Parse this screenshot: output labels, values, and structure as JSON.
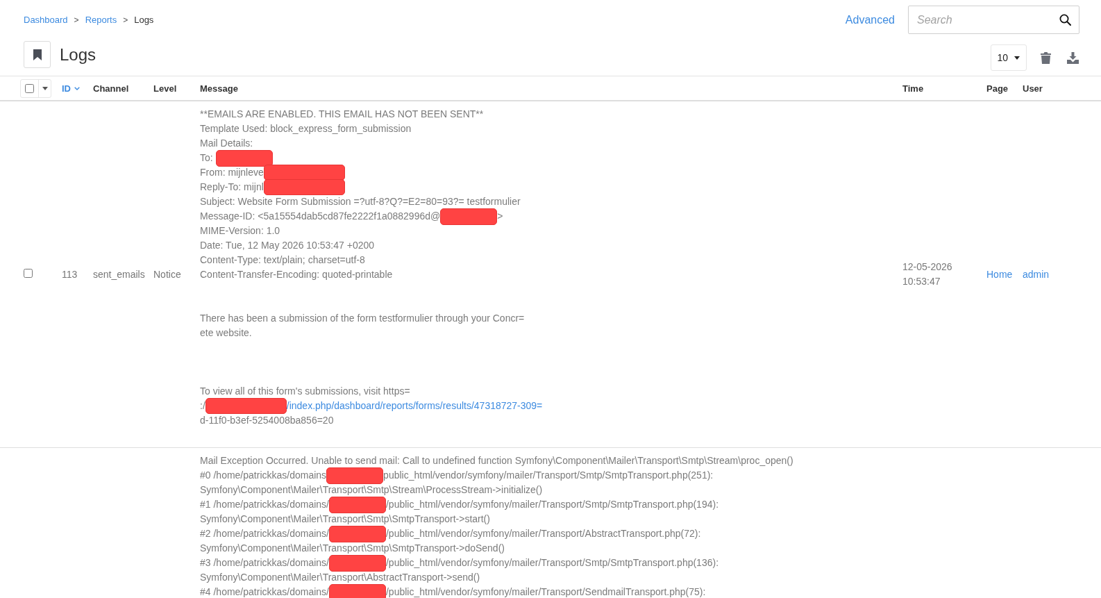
{
  "breadcrumb": [
    {
      "kind": "link",
      "label": "Dashboard"
    },
    {
      "kind": "separator",
      "label": ">"
    },
    {
      "kind": "link",
      "label": "Reports"
    },
    {
      "kind": "separator",
      "label": ">"
    },
    {
      "kind": "current",
      "label": "Logs"
    }
  ],
  "header_actions": {
    "advanced_link": "Advanced",
    "search": {
      "placeholder": "Search"
    }
  },
  "page_title": "Logs",
  "toolbar": {
    "per_page": "10"
  },
  "table": {
    "select_all": {
      "checked": false
    },
    "columns": [
      {
        "label": "ID",
        "sorted": true
      },
      {
        "label": "Channel",
        "sorted": false
      },
      {
        "label": "Level",
        "sorted": false
      },
      {
        "label": "Message",
        "sorted": false
      },
      {
        "label": "Time",
        "sorted": false
      },
      {
        "label": "Page",
        "sorted": false
      },
      {
        "label": "User",
        "sorted": false
      }
    ],
    "rows": [
      {
        "selected": false,
        "id": "113",
        "channel": "sent_emails",
        "level": "Notice",
        "time": "12-05-2026 10:53:47",
        "page": "Home",
        "user": "admin",
        "message": [
          {
            "kind": "text",
            "text": "**EMAILS ARE ENABLED. THIS EMAIL HAS NOT BEEN SENT**"
          },
          {
            "kind": "text",
            "text": "Template Used: block_express_form_submission"
          },
          {
            "kind": "text",
            "text": "Mail Details:"
          },
          {
            "kind": "mixed",
            "parts": [
              {
                "kind": "text",
                "text": "To: "
              },
              {
                "kind": "redaction"
              }
            ]
          },
          {
            "kind": "mixed",
            "parts": [
              {
                "kind": "text",
                "text": "From: mijnleve"
              },
              {
                "kind": "wide_redaction"
              }
            ]
          },
          {
            "kind": "mixed",
            "parts": [
              {
                "kind": "text",
                "text": "Reply-To: mijnl"
              },
              {
                "kind": "wide_redaction"
              }
            ]
          },
          {
            "kind": "text",
            "text": "Subject: Website Form Submission =?utf-8?Q?=E2=80=93?= testformulier"
          },
          {
            "kind": "mixed",
            "parts": [
              {
                "kind": "text",
                "text": "Message-ID: <5a15554dab5cd87fe2222f1a0882996d@"
              },
              {
                "kind": "redaction"
              },
              {
                "kind": "text",
                "text": ">"
              }
            ]
          },
          {
            "kind": "text",
            "text": "MIME-Version: 1.0"
          },
          {
            "kind": "text",
            "text": "Date: Tue, 12 May 2026 10:53:47 +0200"
          },
          {
            "kind": "text",
            "text": "Content-Type: text/plain; charset=utf-8"
          },
          {
            "kind": "text",
            "text": "Content-Transfer-Encoding: quoted-printable"
          },
          {
            "kind": "blank"
          },
          {
            "kind": "blank"
          },
          {
            "kind": "text",
            "text": "There has been a submission of the form testformulier through your Concr="
          },
          {
            "kind": "text",
            "text": "ete website."
          },
          {
            "kind": "blank"
          },
          {
            "kind": "blank"
          },
          {
            "kind": "blank"
          },
          {
            "kind": "text",
            "text": "To view all of this form's submissions, visit https="
          },
          {
            "kind": "mixed",
            "parts": [
              {
                "kind": "text",
                "text": ":/"
              },
              {
                "kind": "wide_redaction"
              },
              {
                "kind": "link",
                "text": "/index.php/dashboard/reports/forms/results/47318727-309="
              }
            ]
          },
          {
            "kind": "text",
            "text": "d-11f0-b3ef-5254008ba856=20"
          }
        ]
      },
      {
        "message": [
          {
            "kind": "text",
            "text": "Mail Exception Occurred. Unable to send mail: Call to undefined function Symfony\\Component\\Mailer\\Transport\\Smtp\\Stream\\proc_open()"
          },
          {
            "kind": "mixed",
            "parts": [
              {
                "kind": "text",
                "text": "#0 /home/patrickkas/domains"
              },
              {
                "kind": "redaction"
              },
              {
                "kind": "text",
                "text": "public_html/vendor/symfony/mailer/Transport/Smtp/SmtpTransport.php(251):"
              }
            ]
          },
          {
            "kind": "text",
            "text": "Symfony\\Component\\Mailer\\Transport\\Smtp\\Stream\\ProcessStream->initialize()"
          },
          {
            "kind": "mixed",
            "parts": [
              {
                "kind": "text",
                "text": "#1 /home/patrickkas/domains/"
              },
              {
                "kind": "redaction"
              },
              {
                "kind": "text",
                "text": "/public_html/vendor/symfony/mailer/Transport/Smtp/SmtpTransport.php(194):"
              }
            ]
          },
          {
            "kind": "text",
            "text": "Symfony\\Component\\Mailer\\Transport\\Smtp\\SmtpTransport->start()"
          },
          {
            "kind": "mixed",
            "parts": [
              {
                "kind": "text",
                "text": "#2 /home/patrickkas/domains/"
              },
              {
                "kind": "redaction"
              },
              {
                "kind": "text",
                "text": "/public_html/vendor/symfony/mailer/Transport/AbstractTransport.php(72):"
              }
            ]
          },
          {
            "kind": "text",
            "text": "Symfony\\Component\\Mailer\\Transport\\Smtp\\SmtpTransport->doSend()"
          },
          {
            "kind": "mixed",
            "parts": [
              {
                "kind": "text",
                "text": "#3 /home/patrickkas/domains/"
              },
              {
                "kind": "redaction"
              },
              {
                "kind": "text",
                "text": "/public_html/vendor/symfony/mailer/Transport/Smtp/SmtpTransport.php(136):"
              }
            ]
          },
          {
            "kind": "text",
            "text": "Symfony\\Component\\Mailer\\Transport\\AbstractTransport->send()"
          },
          {
            "kind": "mixed",
            "parts": [
              {
                "kind": "text",
                "text": "#4 /home/patrickkas/domains/"
              },
              {
                "kind": "redaction"
              },
              {
                "kind": "text",
                "text": "/public_html/vendor/symfony/mailer/Transport/SendmailTransport.php(75):"
              }
            ]
          }
        ]
      }
    ]
  }
}
